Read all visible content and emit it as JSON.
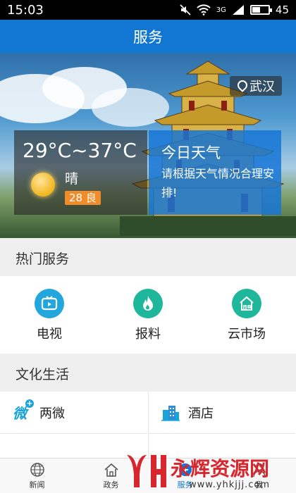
{
  "status": {
    "time": "15:03",
    "signal": "3G",
    "battery": "45",
    "battery_level": 0.45
  },
  "header": {
    "title": "服务"
  },
  "banner": {
    "city": "武汉",
    "weather": {
      "temp_range": "29°C~37°C",
      "condition": "晴",
      "aqi": "28 良"
    },
    "today": {
      "title": "今日天气",
      "text": "请根据天气情况合理安排!"
    }
  },
  "hot_services": {
    "title": "热门服务",
    "items": [
      {
        "label": "电视",
        "icon": "tv-icon",
        "color": "#22a6de"
      },
      {
        "label": "报料",
        "icon": "flame-icon",
        "color": "#1fb79b"
      },
      {
        "label": "云市场",
        "icon": "store-icon",
        "color": "#1fb79b"
      }
    ]
  },
  "culture": {
    "title": "文化生活",
    "items": [
      {
        "label": "两微",
        "icon": "weibo-weixin-icon"
      },
      {
        "label": "酒店",
        "icon": "hotel-building-icon"
      }
    ]
  },
  "bottom_nav": [
    {
      "label": "新闻",
      "icon": "globe-icon"
    },
    {
      "label": "政务",
      "icon": "home-icon"
    },
    {
      "label": "服务",
      "icon": "service-icon",
      "active": true
    },
    {
      "label": "我",
      "icon": "user-icon"
    }
  ],
  "watermark": {
    "text": "永辉资源网",
    "url": "www.yhkjjj.com"
  },
  "colors": {
    "primary": "#1276d3",
    "aqi_badge": "#f08c2a",
    "watermark": "#d8262e"
  }
}
